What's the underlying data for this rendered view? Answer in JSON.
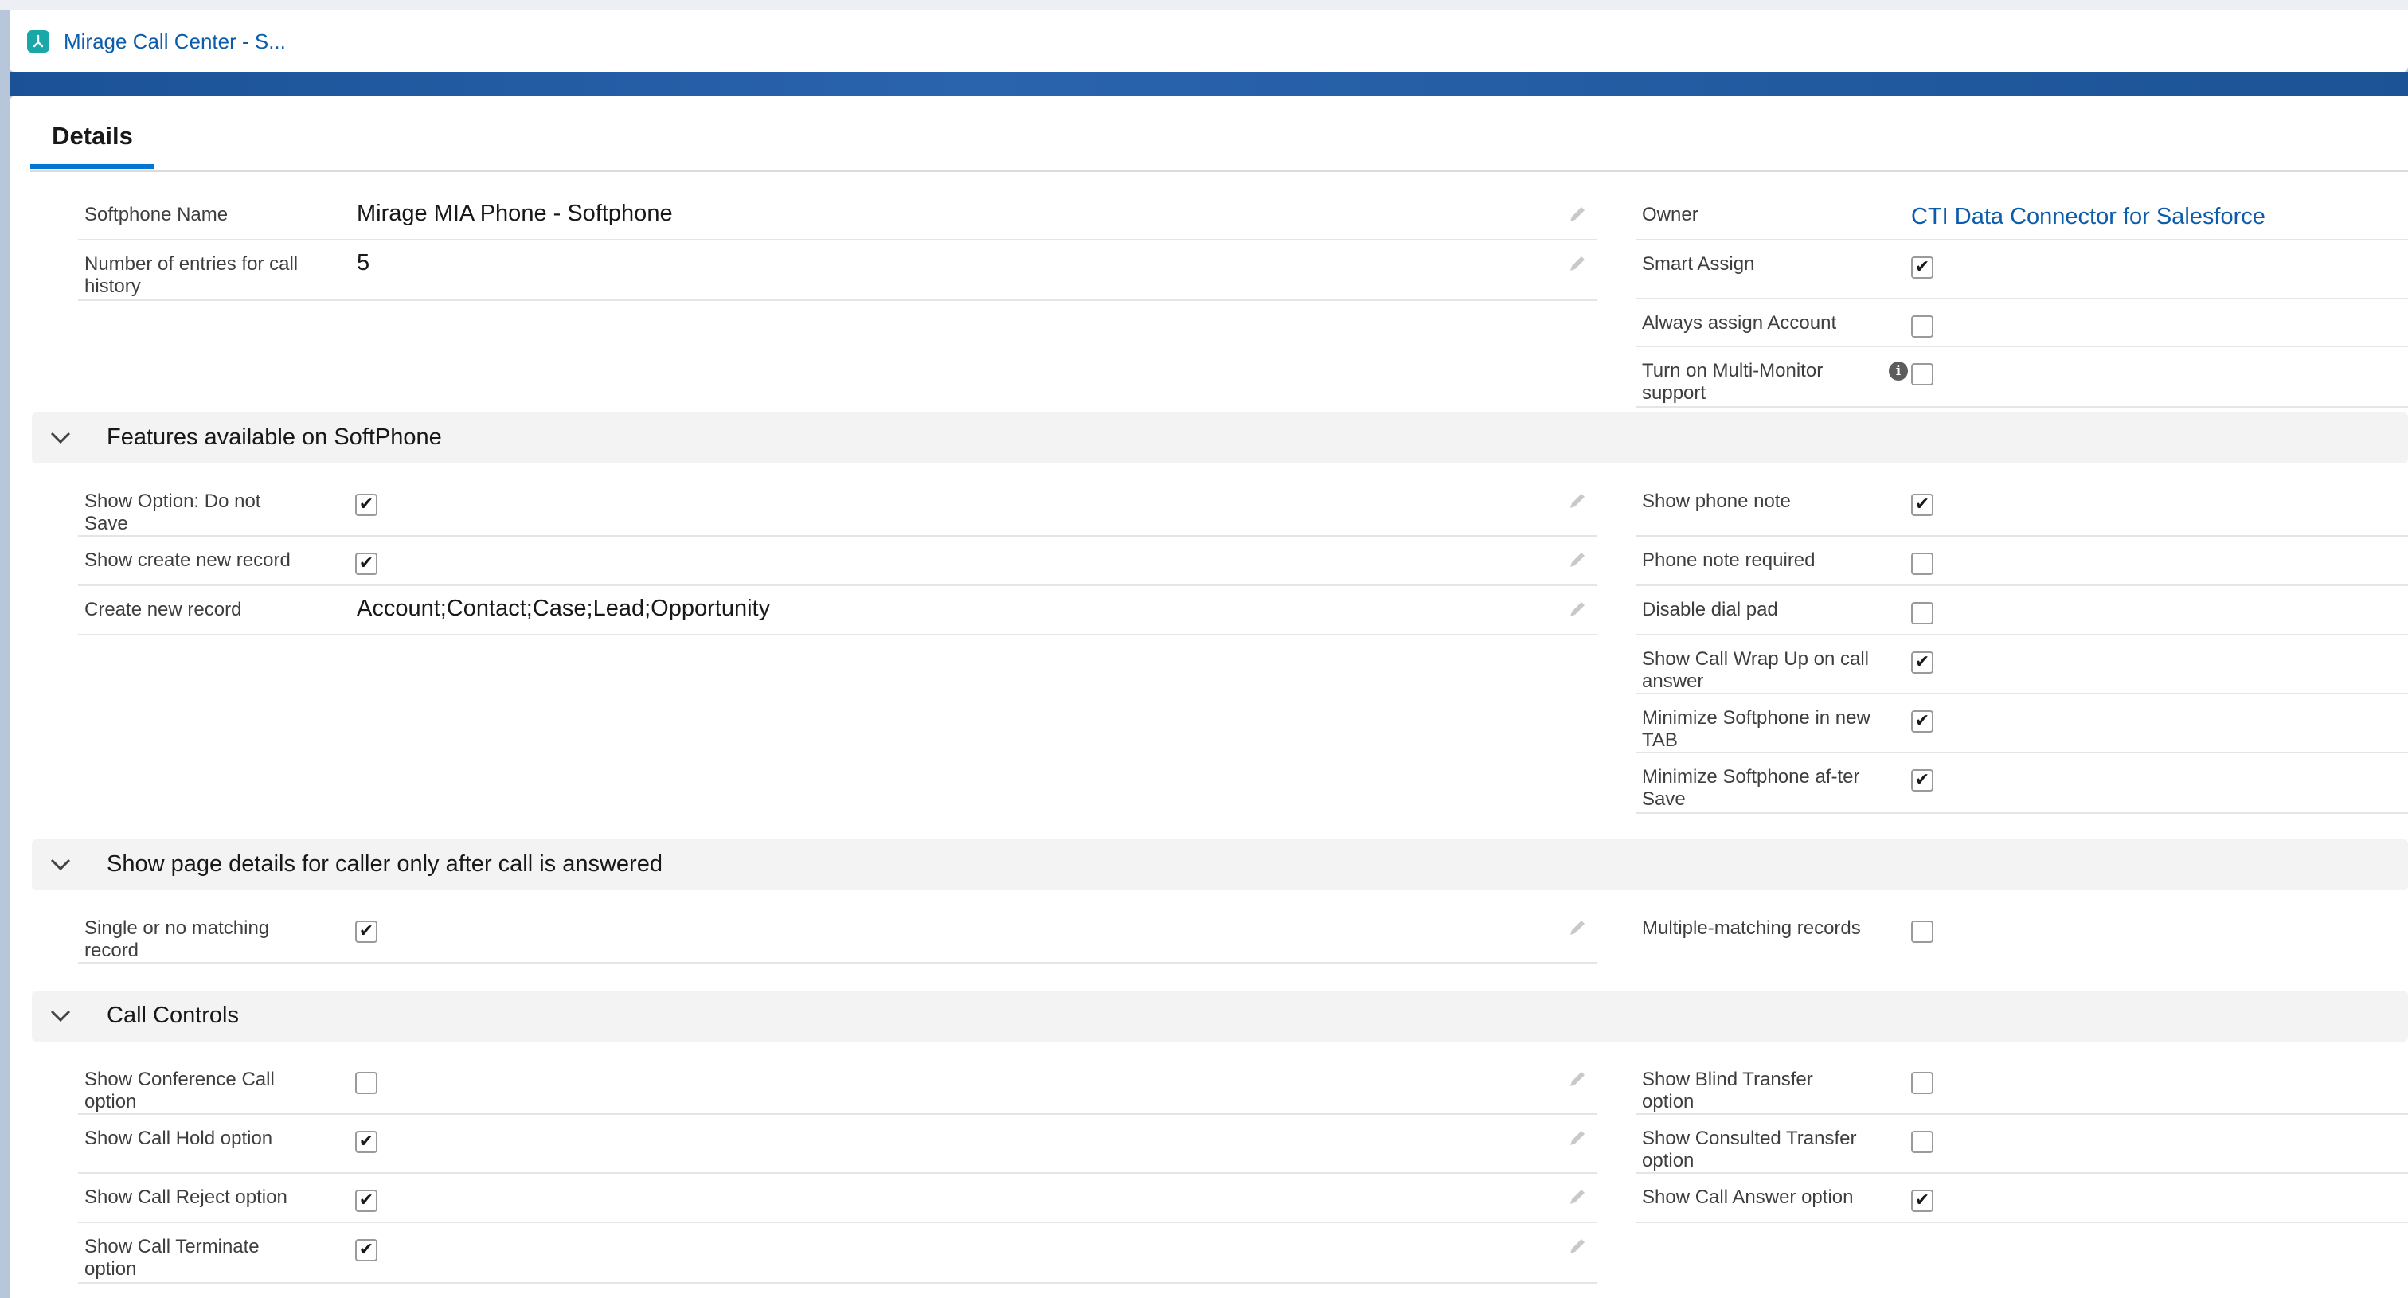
{
  "window": {
    "tab_label": "Mirage Call Center - S..."
  },
  "detail_tab": {
    "label": "Details"
  },
  "top_fields": {
    "left": [
      {
        "label": "Softphone Name",
        "value": "Mirage MIA Phone - Softphone"
      },
      {
        "label": "Number of entries for call history",
        "value": "5"
      }
    ],
    "right": [
      {
        "label": "Owner",
        "value": "CTI Data Connector for Salesforce"
      },
      {
        "label": "Smart Assign",
        "checked": true
      },
      {
        "label": "Always assign Account",
        "checked": false
      },
      {
        "label": "Turn on Multi-Monitor support",
        "checked": false,
        "info_icon": "info-icon"
      }
    ]
  },
  "sections": [
    {
      "title": "Features available on SoftPhone",
      "left": [
        {
          "label": "Show Option: Do not Save",
          "checked": true
        },
        {
          "label": "Show create new record",
          "checked": true
        },
        {
          "label": "Create new record",
          "value": "Account;Contact;Case;Lead;Opportunity"
        }
      ],
      "right": [
        {
          "label": "Show phone note",
          "checked": true
        },
        {
          "label": "Phone note required",
          "checked": false
        },
        {
          "label": "Disable dial pad",
          "checked": false
        },
        {
          "label": "Show Call Wrap Up on call answer",
          "checked": true
        },
        {
          "label": "Minimize Softphone in new TAB",
          "checked": true
        },
        {
          "label": "Minimize Softphone af-ter Save",
          "checked": true
        }
      ]
    },
    {
      "title": "Show page details for caller only after call is answered",
      "left": [
        {
          "label": "Single or no matching record",
          "checked": true
        }
      ],
      "right": [
        {
          "label": "Multiple-matching records",
          "checked": false
        }
      ]
    },
    {
      "title": "Call Controls",
      "left": [
        {
          "label": "Show Conference Call option",
          "checked": false
        },
        {
          "label": "Show Call Hold option",
          "checked": true
        },
        {
          "label": "Show Call Reject option",
          "checked": true
        },
        {
          "label": "Show Call Terminate option",
          "checked": true
        }
      ],
      "right": [
        {
          "label": "Show Blind Transfer option",
          "checked": false
        },
        {
          "label": "Show Consulted Transfer option",
          "checked": false
        },
        {
          "label": "Show Call Answer option",
          "checked": true
        }
      ]
    }
  ],
  "glyphs": {
    "check": "✔"
  },
  "colors": {
    "link": "#0b5cab",
    "tab_underline": "#0176d3",
    "section_bg": "#f3f3f3"
  }
}
